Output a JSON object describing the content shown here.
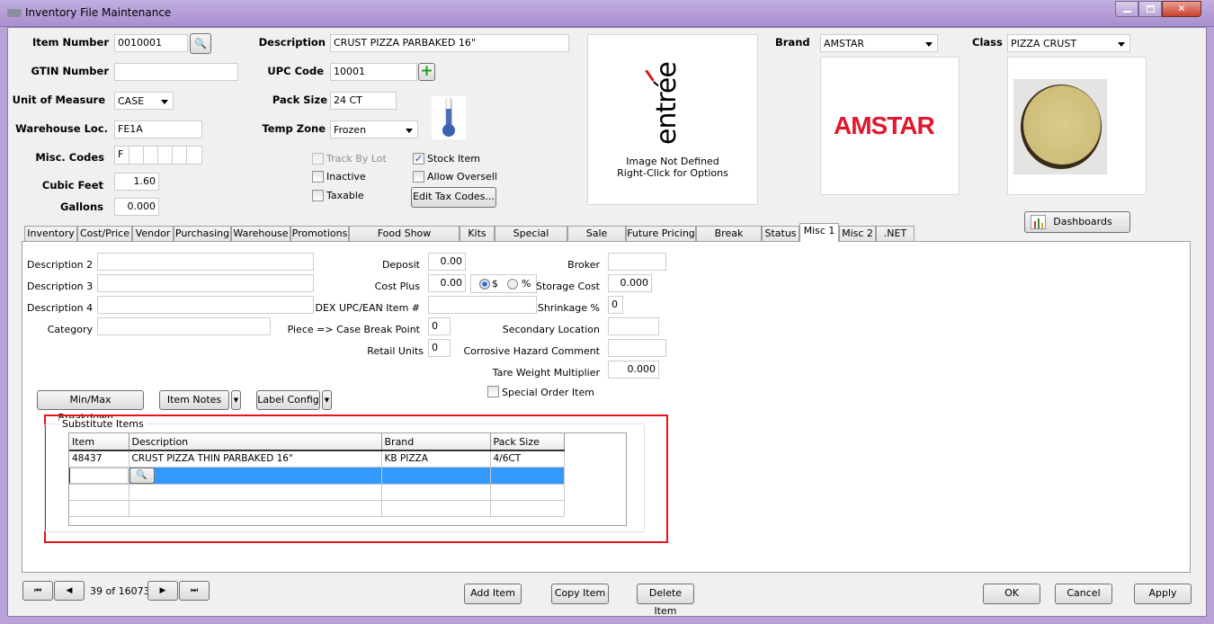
{
  "window": {
    "title": "Inventory File Maintenance"
  },
  "header": {
    "item_number_label": "Item Number",
    "item_number": "0010001",
    "gtin_label": "GTIN Number",
    "gtin": "",
    "uom_label": "Unit of Measure",
    "uom": "CASE",
    "warehouse_loc_label": "Warehouse Loc.",
    "warehouse_loc": "FE1A",
    "misc_codes_label": "Misc. Codes",
    "misc_codes": [
      "F",
      "",
      "",
      "",
      "",
      ""
    ],
    "cubic_feet_label": "Cubic Feet",
    "cubic_feet": "1.60",
    "gallons_label": "Gallons",
    "gallons": "0.000",
    "description_label": "Description",
    "description": "CRUST PIZZA PARBAKED 16\"",
    "upc_label": "UPC Code",
    "upc": "10001",
    "pack_size_label": "Pack Size",
    "pack_size": "24 CT",
    "temp_zone_label": "Temp Zone",
    "temp_zone": "Frozen",
    "checkboxes": {
      "track_by_lot": {
        "label": "Track By Lot",
        "checked": false,
        "disabled": true
      },
      "inactive": {
        "label": "Inactive",
        "checked": false
      },
      "taxable": {
        "label": "Taxable",
        "checked": false
      },
      "stock_item": {
        "label": "Stock Item",
        "checked": true
      },
      "allow_oversell": {
        "label": "Allow Oversell",
        "checked": false
      }
    },
    "edit_tax_codes": "Edit Tax Codes...",
    "image_msg1": "Image Not Defined",
    "image_msg2": "Right-Click for Options",
    "logo_text": "entrée",
    "brand_label": "Brand",
    "brand": "AMSTAR",
    "brand_logo_text": "AMSTAR",
    "class_label": "Class",
    "class": "PIZZA CRUST",
    "dashboards": "Dashboards"
  },
  "tabs": [
    "Inventory",
    "Cost/Price",
    "Vendor",
    "Purchasing",
    "Warehouse",
    "Promotions",
    "Food Show Promotions",
    "Kits",
    "Special Pricing",
    "Sale Pricing",
    "Future Pricing",
    "Break Pricing",
    "Status",
    "Misc 1",
    "Misc 2",
    ".NET"
  ],
  "active_tab": "Misc 1",
  "misc1": {
    "desc2_label": "Description 2",
    "desc2": "",
    "desc3_label": "Description 3",
    "desc3": "",
    "desc4_label": "Description 4",
    "desc4": "",
    "category_label": "Category",
    "category": "",
    "deposit_label": "Deposit",
    "deposit": "0.00",
    "cost_plus_label": "Cost Plus",
    "cost_plus": "0.00",
    "cost_plus_dollar": "$",
    "cost_plus_percent": "%",
    "cost_plus_mode": "$",
    "dex_label": "DEX UPC/EAN Item #",
    "dex": "",
    "piece_case_label": "Piece => Case Break Point",
    "piece_case": "0",
    "retail_units_label": "Retail Units",
    "retail_units": "0",
    "broker_label": "Broker",
    "broker": "",
    "storage_cost_label": "Storage Cost",
    "storage_cost": "0.000",
    "shrinkage_label": "Shrinkage %",
    "shrinkage": "0",
    "secondary_loc_label": "Secondary Location",
    "secondary_loc": "",
    "corrosive_label": "Corrosive Hazard Comment",
    "corrosive": "",
    "tare_label": "Tare Weight Multiplier",
    "tare": "0.000",
    "special_order_label": "Special Order Item",
    "special_order": false,
    "minmax_btn": "Min/Max Breakdown...",
    "item_notes_btn": "Item Notes",
    "label_config_btn": "Label Config",
    "substitute": {
      "title": "Substitute Items",
      "columns": [
        "Item",
        "Description",
        "Brand",
        "Pack Size"
      ],
      "rows": [
        {
          "item": "48437",
          "description": "CRUST PIZZA THIN PARBAKED 16\"",
          "brand": "KB PIZZA",
          "pack_size": "4/6CT"
        }
      ]
    }
  },
  "footer": {
    "record": "39 of 16073",
    "add": "Add Item",
    "copy": "Copy Item",
    "delete": "Delete Item",
    "ok": "OK",
    "cancel": "Cancel",
    "apply": "Apply"
  },
  "colors": {
    "highlight_border": "#e8141c",
    "selected_row": "#3399ff",
    "title_bar": "#b39bd9"
  }
}
